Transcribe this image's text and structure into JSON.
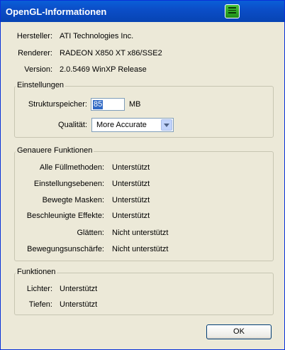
{
  "window": {
    "title": "OpenGL-Informationen"
  },
  "info": {
    "vendor_label": "Hersteller:",
    "vendor_value": "ATI Technologies Inc.",
    "renderer_label": "Renderer:",
    "renderer_value": "RADEON X850 XT x86/SSE2",
    "version_label": "Version:",
    "version_value": "2.0.5469 WinXP Release"
  },
  "settings": {
    "legend": "Einstellungen",
    "texture_label": "Strukturspeicher:",
    "texture_value": "85",
    "texture_unit": "MB",
    "quality_label": "Qualität:",
    "quality_value": "More Accurate"
  },
  "advanced": {
    "legend": "Genauere Funktionen",
    "rows": [
      {
        "label": "Alle Füllmethoden:",
        "value": "Unterstützt"
      },
      {
        "label": "Einstellungsebenen:",
        "value": "Unterstützt"
      },
      {
        "label": "Bewegte Masken:",
        "value": "Unterstützt"
      },
      {
        "label": "Beschleunigte Effekte:",
        "value": "Unterstützt"
      },
      {
        "label": "Glätten:",
        "value": "Nicht unterstützt"
      },
      {
        "label": "Bewegungsunschärfe:",
        "value": "Nicht unterstützt"
      }
    ]
  },
  "functions": {
    "legend": "Funktionen",
    "rows": [
      {
        "label": "Lichter:",
        "value": "Unterstützt"
      },
      {
        "label": "Tiefen:",
        "value": "Unterstützt"
      }
    ]
  },
  "buttons": {
    "ok_label": "OK"
  }
}
